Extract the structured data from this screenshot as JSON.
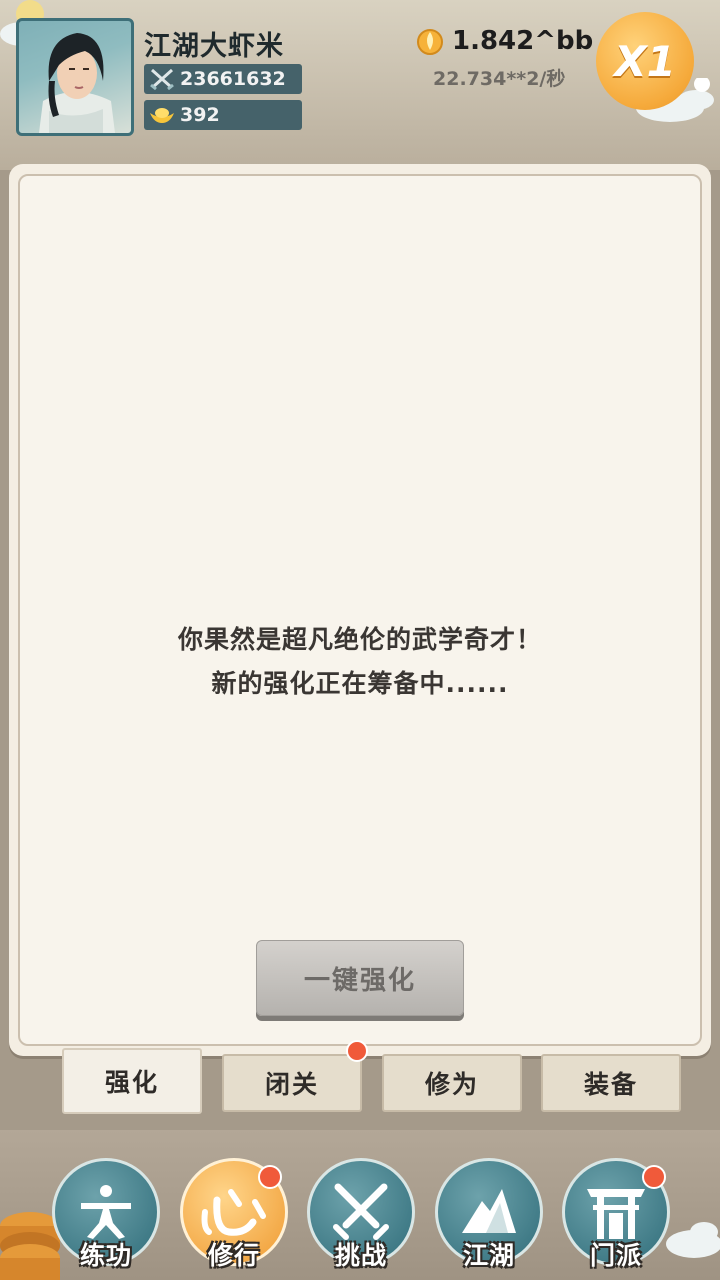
{
  "header": {
    "player_name": "江湖大虾米",
    "power": "23661632",
    "ingots": "392",
    "gold": "1.842^bb",
    "gold_rate": "22.734**2/秒",
    "speed_multiplier": "X1"
  },
  "panel": {
    "message_line1": "你果然是超凡绝伦的武学奇才！",
    "message_line2": "新的强化正在筹备中......",
    "one_key_button": "一键强化",
    "one_key_button_enabled": false
  },
  "sub_tabs": [
    {
      "label": "强化",
      "active": true,
      "badge": false
    },
    {
      "label": "闭关",
      "active": false,
      "badge": true
    },
    {
      "label": "修为",
      "active": false,
      "badge": false
    },
    {
      "label": "装备",
      "active": false,
      "badge": false
    }
  ],
  "bottom_nav": [
    {
      "label": "练功",
      "icon": "practice-figure-icon",
      "active": false,
      "badge": false
    },
    {
      "label": "修行",
      "icon": "heart-character-icon",
      "active": true,
      "badge": true
    },
    {
      "label": "挑战",
      "icon": "crossed-swords-icon",
      "active": false,
      "badge": false
    },
    {
      "label": "江湖",
      "icon": "mountain-icon",
      "active": false,
      "badge": false
    },
    {
      "label": "门派",
      "icon": "sect-gate-icon",
      "active": false,
      "badge": true
    }
  ],
  "colors": {
    "panel_bg": "#f8f4ec",
    "nav_teal": "#3f7a86",
    "nav_active_orange": "#f3a947",
    "badge_red": "#f05a3a",
    "stat_box": "#45626a"
  }
}
